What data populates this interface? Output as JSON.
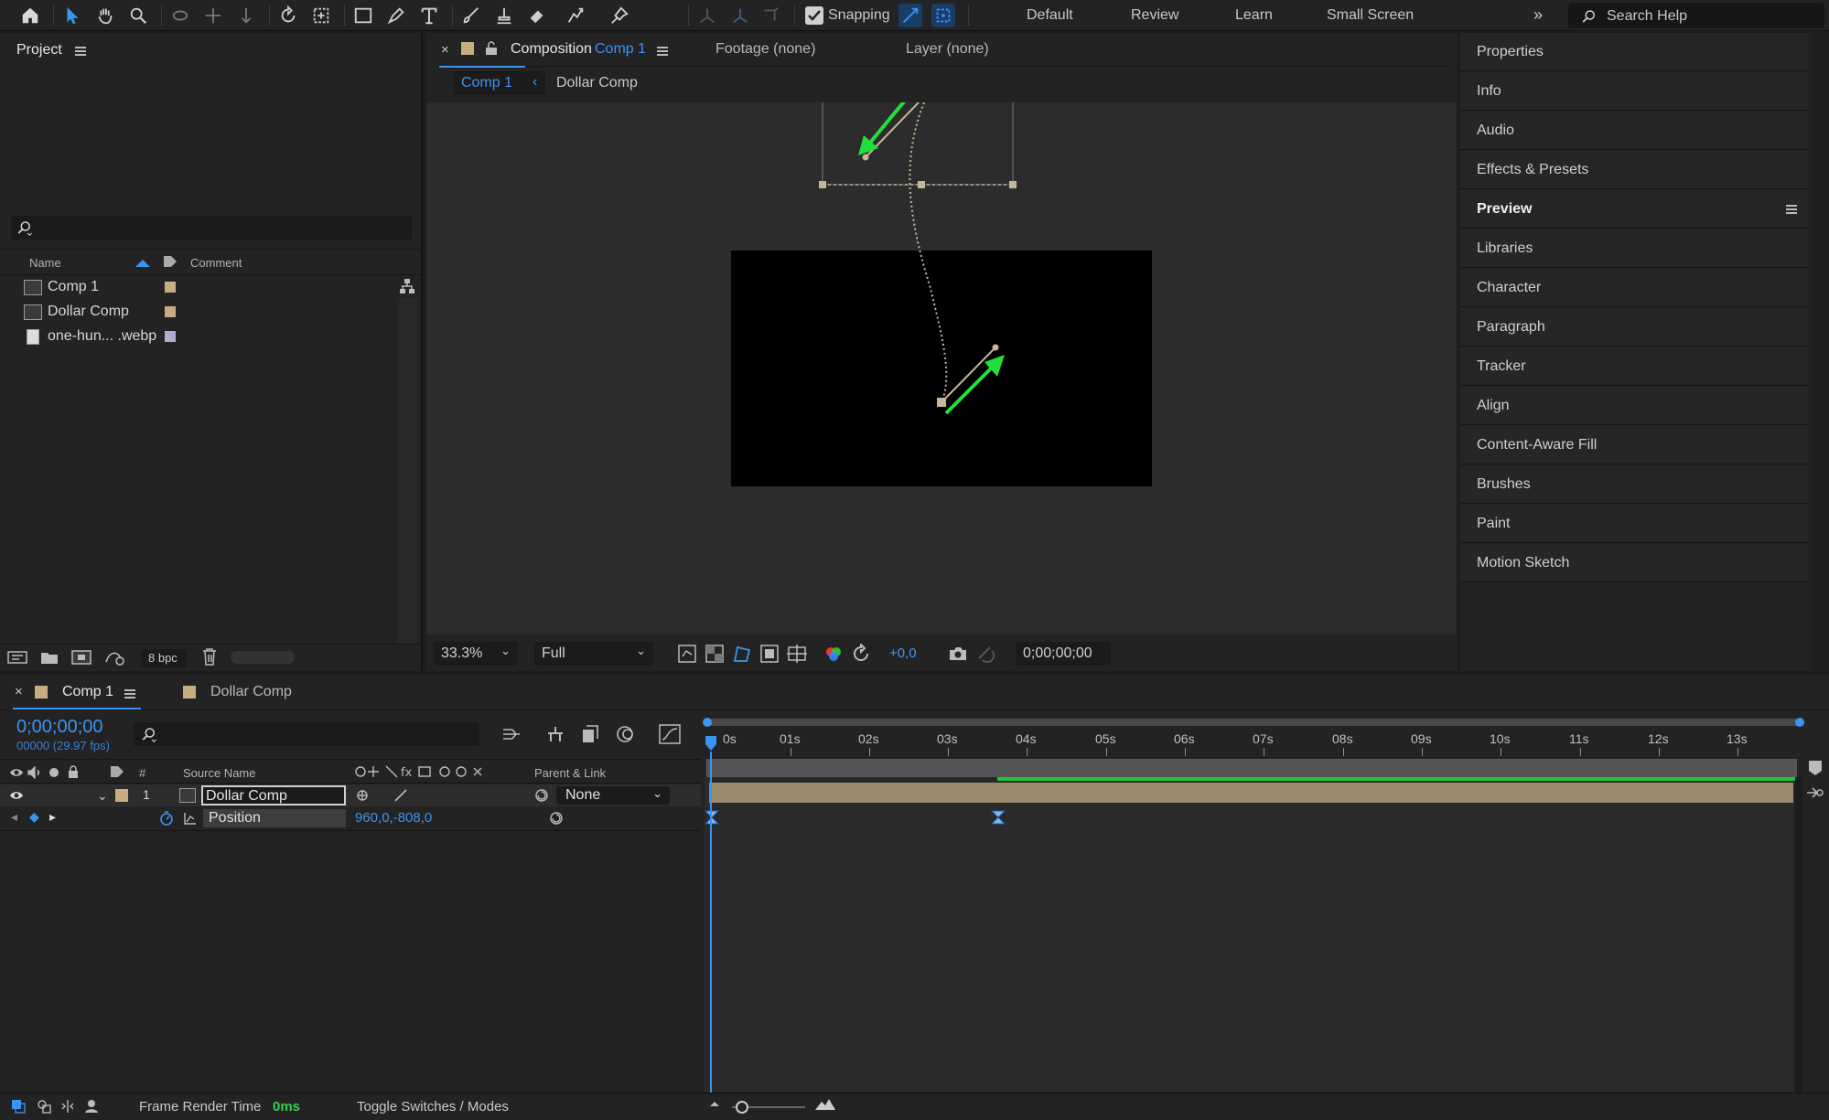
{
  "toolbar": {
    "snapping_label": "Snapping",
    "snapping_checked": true,
    "workspaces": [
      "Default",
      "Review",
      "Learn",
      "Small Screen"
    ],
    "search_placeholder": "Search Help"
  },
  "project": {
    "title": "Project",
    "columns": {
      "name": "Name",
      "comment": "Comment"
    },
    "items": [
      {
        "name": "Comp 1",
        "type": "comp",
        "label_color": "#c8ad82"
      },
      {
        "name": "Dollar Comp",
        "type": "comp",
        "label_color": "#c8ad82"
      },
      {
        "name": "one-hun... .webp",
        "type": "file",
        "label_color": "#b7a9d6"
      }
    ],
    "bpc": "8 bpc"
  },
  "composition": {
    "close": "×",
    "title_prefix": "Composition",
    "title_name": "Comp 1",
    "footage_tab": "Footage (none)",
    "layer_tab": "Layer (none)",
    "breadcrumb": [
      "Comp 1",
      "Dollar Comp"
    ],
    "zoom": "33.3%",
    "resolution": "Full",
    "exposure": "+0,0",
    "timecode": "0;00;00;00"
  },
  "right_panel": {
    "items": [
      "Properties",
      "Info",
      "Audio",
      "Effects & Presets",
      "Preview",
      "Libraries",
      "Character",
      "Paragraph",
      "Tracker",
      "Align",
      "Content-Aware Fill",
      "Brushes",
      "Paint",
      "Motion Sketch"
    ],
    "active": "Preview"
  },
  "timeline": {
    "tabs": [
      {
        "name": "Comp 1",
        "label_color": "#c8ad82"
      },
      {
        "name": "Dollar Comp",
        "label_color": "#c8ad82"
      }
    ],
    "close": "×",
    "timecode": "0;00;00;00",
    "frame_info": "00000 (29.97 fps)",
    "columns": {
      "number": "#",
      "source_name": "Source Name",
      "parent": "Parent & Link"
    },
    "ruler_labels": [
      "0s",
      "01s",
      "02s",
      "03s",
      "04s",
      "05s",
      "06s",
      "07s",
      "08s",
      "09s",
      "10s",
      "11s",
      "12s",
      "13s"
    ],
    "layer": {
      "index": "1",
      "name": "Dollar Comp",
      "parent": "None"
    },
    "property": {
      "name": "Position",
      "value": "960,0,-808,0"
    }
  },
  "status": {
    "frame_render_label": "Frame Render Time",
    "frame_render_value": "0ms",
    "toggle_label": "Toggle Switches / Modes"
  }
}
